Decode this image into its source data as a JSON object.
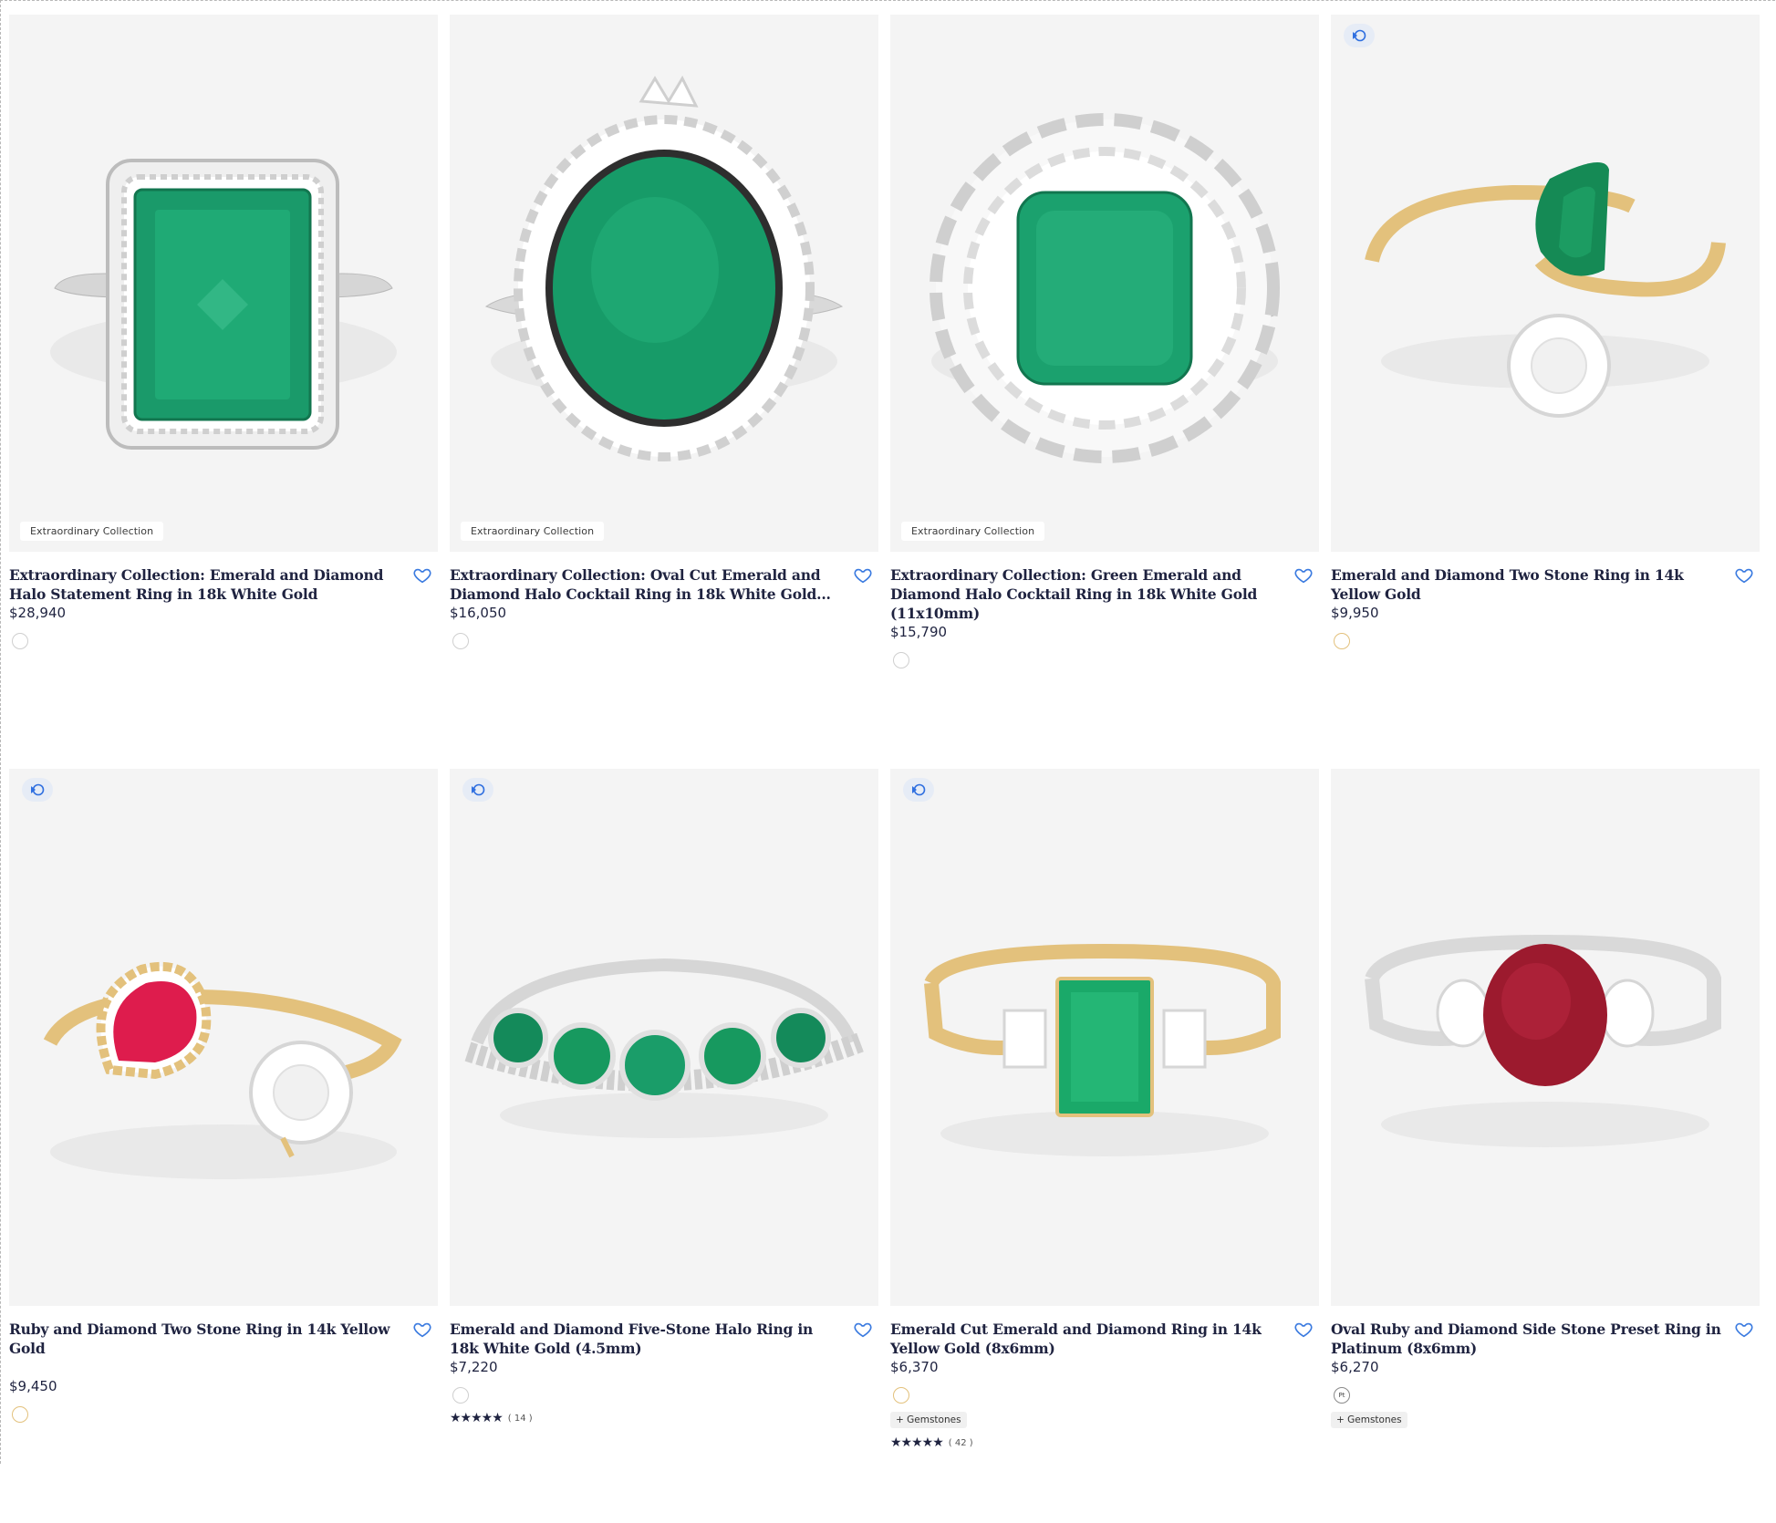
{
  "products": [
    {
      "badge": "Extraordinary Collection",
      "title": "Extraordinary Collection: Emerald and Diamond Halo Statement Ring in 18k White Gold",
      "price": "$28,940",
      "metal": "white",
      "has_video": false
    },
    {
      "badge": "Extraordinary Collection",
      "title": "Extraordinary Collection: Oval Cut Emerald and Diamond Halo Cocktail Ring in 18k White Gold...",
      "price": "$16,050",
      "metal": "white",
      "has_video": false
    },
    {
      "badge": "Extraordinary Collection",
      "title": "Extraordinary Collection: Green Emerald and Diamond Halo Cocktail Ring in 18k White Gold (11x10mm)",
      "price": "$15,790",
      "metal": "white",
      "has_video": false
    },
    {
      "badge": "",
      "title": "Emerald and Diamond Two Stone Ring in 14k Yellow Gold",
      "price": "$9,950",
      "metal": "yellow",
      "has_video": true
    },
    {
      "badge": "",
      "title": "Ruby and Diamond Two Stone Ring in 14k Yellow Gold",
      "price": "$9,450",
      "metal": "yellow",
      "has_video": true
    },
    {
      "badge": "",
      "title": "Emerald and Diamond Five-Stone Halo Ring in 18k White Gold (4.5mm)",
      "price": "$7,220",
      "metal": "white",
      "has_video": true,
      "rating_stars": "★★★★★",
      "rating_count": "( 14 )"
    },
    {
      "badge": "",
      "title": "Emerald Cut Emerald and Diamond Ring in 14k Yellow Gold (8x6mm)",
      "price": "$6,370",
      "metal": "yellow",
      "has_video": true,
      "gem_tag": "+ Gemstones",
      "rating_stars": "★★★★★",
      "rating_count": "( 42 )"
    },
    {
      "badge": "",
      "title": "Oval Ruby and Diamond Side Stone Preset Ring in Platinum (8x6mm)",
      "price": "$6,270",
      "metal": "platinum",
      "metal_label": "Pt",
      "has_video": false,
      "gem_tag": "+ Gemstones"
    }
  ],
  "colors": {
    "emerald": "#1a9a6a",
    "ruby": "#d8204a",
    "dark_ruby": "#9c1a2e",
    "yellow_gold": "#e3c17c",
    "white_gold": "#d9d9d9",
    "heart": "#3b7be0",
    "text": "#1f2340"
  },
  "icons": {
    "wishlist": "heart-icon",
    "video": "video-icon"
  }
}
